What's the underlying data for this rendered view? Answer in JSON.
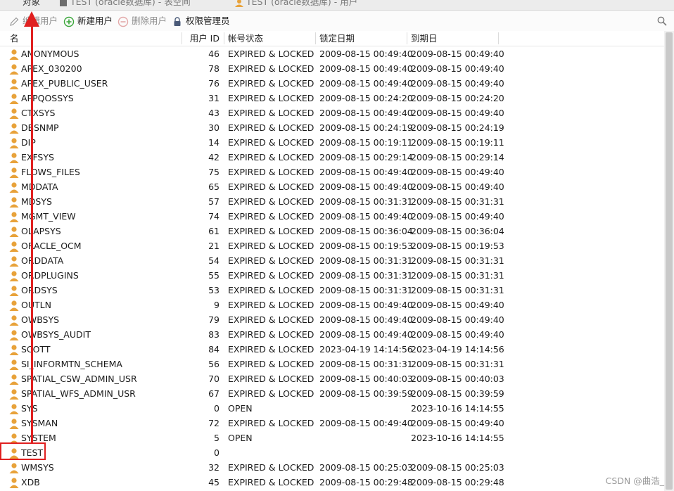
{
  "tabs": [
    {
      "label": "对象"
    },
    {
      "label": "TEST (oracle数据库) - 表空间"
    },
    {
      "label": "TEST (oracle数据库) - 用户"
    }
  ],
  "toolbar": {
    "edit_user": "编辑用户",
    "new_user": "新建用户",
    "delete_user": "删除用户",
    "privilege_manager": "权限管理员"
  },
  "columns": {
    "name": "名",
    "user_id": "用户 ID",
    "account_status": "帐号状态",
    "lock_date": "锁定日期",
    "expiry_date": "到期日"
  },
  "users": [
    {
      "name": "ANONYMOUS",
      "id": "46",
      "status": "EXPIRED & LOCKED",
      "lock": "2009-08-15 00:49:40",
      "expiry": "2009-08-15 00:49:40"
    },
    {
      "name": "APEX_030200",
      "id": "78",
      "status": "EXPIRED & LOCKED",
      "lock": "2009-08-15 00:49:40",
      "expiry": "2009-08-15 00:49:40"
    },
    {
      "name": "APEX_PUBLIC_USER",
      "id": "76",
      "status": "EXPIRED & LOCKED",
      "lock": "2009-08-15 00:49:40",
      "expiry": "2009-08-15 00:49:40"
    },
    {
      "name": "APPQOSSYS",
      "id": "31",
      "status": "EXPIRED & LOCKED",
      "lock": "2009-08-15 00:24:20",
      "expiry": "2009-08-15 00:24:20"
    },
    {
      "name": "CTXSYS",
      "id": "43",
      "status": "EXPIRED & LOCKED",
      "lock": "2009-08-15 00:49:40",
      "expiry": "2009-08-15 00:49:40"
    },
    {
      "name": "DBSNMP",
      "id": "30",
      "status": "EXPIRED & LOCKED",
      "lock": "2009-08-15 00:24:19",
      "expiry": "2009-08-15 00:24:19"
    },
    {
      "name": "DIP",
      "id": "14",
      "status": "EXPIRED & LOCKED",
      "lock": "2009-08-15 00:19:11",
      "expiry": "2009-08-15 00:19:11"
    },
    {
      "name": "EXFSYS",
      "id": "42",
      "status": "EXPIRED & LOCKED",
      "lock": "2009-08-15 00:29:14",
      "expiry": "2009-08-15 00:29:14"
    },
    {
      "name": "FLOWS_FILES",
      "id": "75",
      "status": "EXPIRED & LOCKED",
      "lock": "2009-08-15 00:49:40",
      "expiry": "2009-08-15 00:49:40"
    },
    {
      "name": "MDDATA",
      "id": "65",
      "status": "EXPIRED & LOCKED",
      "lock": "2009-08-15 00:49:40",
      "expiry": "2009-08-15 00:49:40"
    },
    {
      "name": "MDSYS",
      "id": "57",
      "status": "EXPIRED & LOCKED",
      "lock": "2009-08-15 00:31:31",
      "expiry": "2009-08-15 00:31:31"
    },
    {
      "name": "MGMT_VIEW",
      "id": "74",
      "status": "EXPIRED & LOCKED",
      "lock": "2009-08-15 00:49:40",
      "expiry": "2009-08-15 00:49:40"
    },
    {
      "name": "OLAPSYS",
      "id": "61",
      "status": "EXPIRED & LOCKED",
      "lock": "2009-08-15 00:36:04",
      "expiry": "2009-08-15 00:36:04"
    },
    {
      "name": "ORACLE_OCM",
      "id": "21",
      "status": "EXPIRED & LOCKED",
      "lock": "2009-08-15 00:19:53",
      "expiry": "2009-08-15 00:19:53"
    },
    {
      "name": "ORDDATA",
      "id": "54",
      "status": "EXPIRED & LOCKED",
      "lock": "2009-08-15 00:31:31",
      "expiry": "2009-08-15 00:31:31"
    },
    {
      "name": "ORDPLUGINS",
      "id": "55",
      "status": "EXPIRED & LOCKED",
      "lock": "2009-08-15 00:31:31",
      "expiry": "2009-08-15 00:31:31"
    },
    {
      "name": "ORDSYS",
      "id": "53",
      "status": "EXPIRED & LOCKED",
      "lock": "2009-08-15 00:31:31",
      "expiry": "2009-08-15 00:31:31"
    },
    {
      "name": "OUTLN",
      "id": "9",
      "status": "EXPIRED & LOCKED",
      "lock": "2009-08-15 00:49:40",
      "expiry": "2009-08-15 00:49:40"
    },
    {
      "name": "OWBSYS",
      "id": "79",
      "status": "EXPIRED & LOCKED",
      "lock": "2009-08-15 00:49:40",
      "expiry": "2009-08-15 00:49:40"
    },
    {
      "name": "OWBSYS_AUDIT",
      "id": "83",
      "status": "EXPIRED & LOCKED",
      "lock": "2009-08-15 00:49:40",
      "expiry": "2009-08-15 00:49:40"
    },
    {
      "name": "SCOTT",
      "id": "84",
      "status": "EXPIRED & LOCKED",
      "lock": "2023-04-19 14:14:56",
      "expiry": "2023-04-19 14:14:56"
    },
    {
      "name": "SI_INFORMTN_SCHEMA",
      "id": "56",
      "status": "EXPIRED & LOCKED",
      "lock": "2009-08-15 00:31:31",
      "expiry": "2009-08-15 00:31:31"
    },
    {
      "name": "SPATIAL_CSW_ADMIN_USR",
      "id": "70",
      "status": "EXPIRED & LOCKED",
      "lock": "2009-08-15 00:40:03",
      "expiry": "2009-08-15 00:40:03"
    },
    {
      "name": "SPATIAL_WFS_ADMIN_USR",
      "id": "67",
      "status": "EXPIRED & LOCKED",
      "lock": "2009-08-15 00:39:59",
      "expiry": "2009-08-15 00:39:59"
    },
    {
      "name": "SYS",
      "id": "0",
      "status": "OPEN",
      "lock": "",
      "expiry": "2023-10-16 14:14:55"
    },
    {
      "name": "SYSMAN",
      "id": "72",
      "status": "EXPIRED & LOCKED",
      "lock": "2009-08-15 00:49:40",
      "expiry": "2009-08-15 00:49:40"
    },
    {
      "name": "SYSTEM",
      "id": "5",
      "status": "OPEN",
      "lock": "",
      "expiry": "2023-10-16 14:14:55"
    },
    {
      "name": "TEST",
      "id": "0",
      "status": "",
      "lock": "",
      "expiry": ""
    },
    {
      "name": "WMSYS",
      "id": "32",
      "status": "EXPIRED & LOCKED",
      "lock": "2009-08-15 00:25:03",
      "expiry": "2009-08-15 00:25:03"
    },
    {
      "name": "XDB",
      "id": "45",
      "status": "EXPIRED & LOCKED",
      "lock": "2009-08-15 00:29:48",
      "expiry": "2009-08-15 00:29:48"
    }
  ],
  "watermark": "CSDN @曲浩_",
  "colors": {
    "annotation": "#e02020",
    "user_icon": "#e8a23a",
    "new_user_icon": "#3aa63a"
  },
  "icons": {
    "edit_user": "pencil-icon",
    "new_user": "plus-circle-icon",
    "delete_user": "minus-circle-icon",
    "privilege_manager": "lock-icon",
    "search": "search-icon",
    "user_row": "user-icon"
  }
}
